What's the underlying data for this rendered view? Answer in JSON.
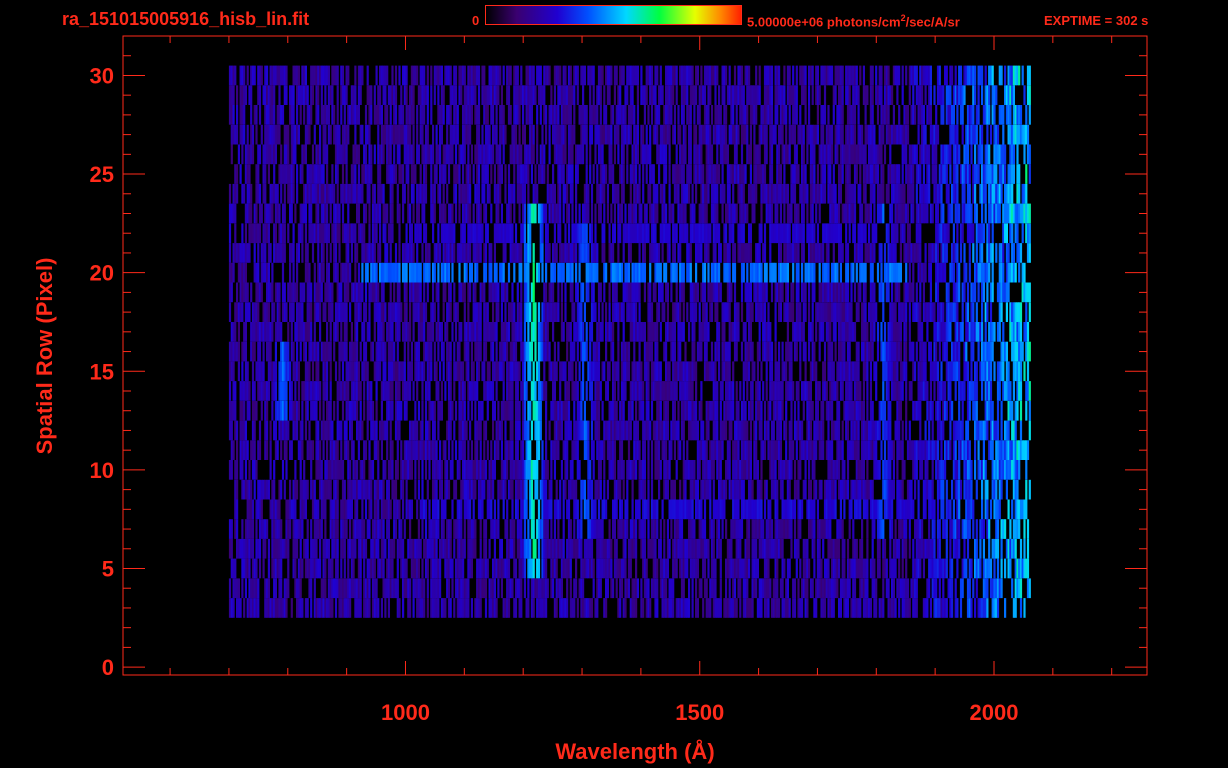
{
  "header": {
    "filename": "ra_151015005916_hisb_lin.fit",
    "colorbar_min": "0",
    "colorbar_max_prefix": "5.00000e+06 photons/cm",
    "colorbar_max_exp": "2",
    "colorbar_max_suffix": "/sec/A/sr",
    "exptime": "EXPTIME = 302 s"
  },
  "colors": {
    "text": "#ff2a1a",
    "frame": "#ff2a1a",
    "background": "#000000"
  },
  "chart_data": {
    "type": "heatmap",
    "xlabel": "Wavelength (Å)",
    "ylabel": "Spatial Row (Pixel)",
    "xlim": [
      520,
      2260
    ],
    "ylim": [
      -0.4,
      32
    ],
    "x_ticks": [
      1000,
      1500,
      2000
    ],
    "y_ticks": [
      0,
      5,
      10,
      15,
      20,
      25,
      30
    ],
    "colormap": "rainbow",
    "value_range": [
      0,
      5000000
    ],
    "data_extent": {
      "x": [
        700,
        2060
      ],
      "rows": [
        3,
        30
      ]
    },
    "features": [
      {
        "name": "vertical line",
        "x": 1216,
        "rows": [
          5,
          23
        ],
        "intensity": 0.62
      },
      {
        "name": "vertical line",
        "x": 1304,
        "rows": [
          7,
          22
        ],
        "intensity": 0.42
      },
      {
        "name": "vertical line",
        "x": 1810,
        "rows": [
          7,
          23
        ],
        "intensity": 0.4
      },
      {
        "name": "vertical line",
        "x": 790,
        "rows": [
          13,
          16
        ],
        "intensity": 0.42
      },
      {
        "name": "horizontal band",
        "row": 20,
        "x": [
          920,
          1850
        ],
        "intensity": 0.45
      },
      {
        "name": "horizontal band",
        "row": 8,
        "x": [
          1020,
          2000
        ],
        "intensity": 0.3
      },
      {
        "name": "horizontal band",
        "row": 22,
        "x": [
          1000,
          1820
        ],
        "intensity": 0.28
      }
    ]
  }
}
